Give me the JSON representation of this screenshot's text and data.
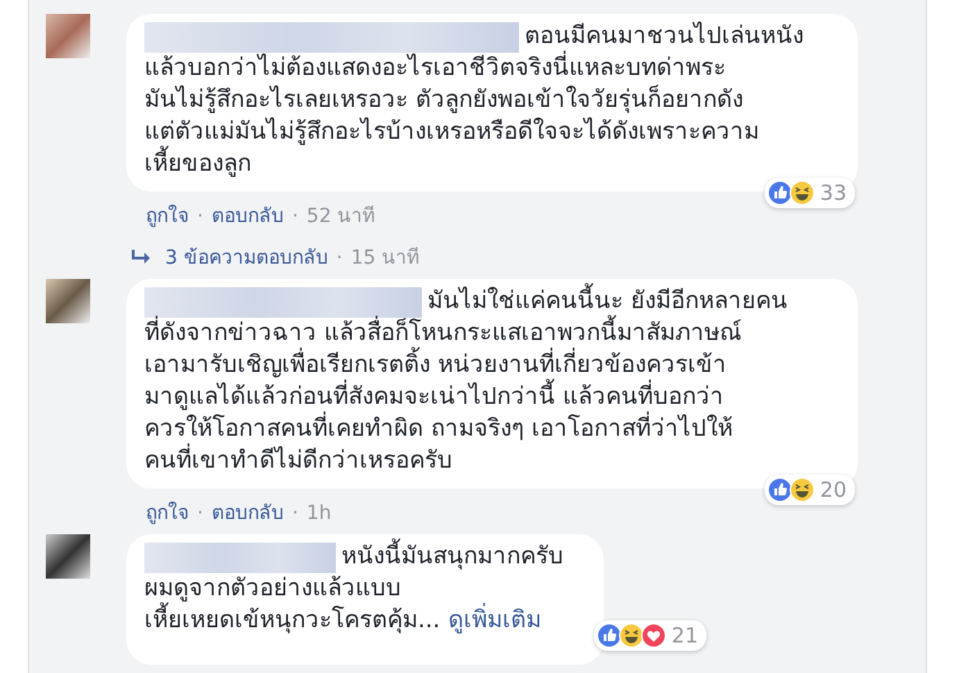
{
  "comments": [
    {
      "lines": [
        "ตอนมีคนมาชวนไปเล่นหนัง",
        "แล้วบอกว่าไม่ต้องแสดงอะไรเอาชีวิตจริงนี่แหละบทด่าพระ",
        "มันไม่รู้สึกอะไรเลยเหรอวะ ตัวลูกยังพอเข้าใจวัยรุ่นก็อยากดัง",
        "แต่ตัวแม่มันไม่รู้สึกอะไรบ้างเหรอหรือดีใจจะได้ดังเพราะความ",
        "เหี้ยของลูก"
      ],
      "reactions": {
        "icons": [
          {
            "kind": "like"
          },
          {
            "kind": "haha"
          }
        ],
        "count": "33"
      },
      "actions": [
        "ถูกใจ",
        "ตอบกลับ"
      ],
      "separator": "·",
      "time": "52 นาที",
      "replies": {
        "label": "3 ข้อความตอบกลับ",
        "time": "15 นาที"
      }
    },
    {
      "lines": [
        "มันไม่ใช่แค่คนนี้นะ ยังมีอีกหลายคน",
        "ที่ดังจากข่าวฉาว แล้วสื่อก็โหนกระแสเอาพวกนี้มาสัมภาษณ์",
        "เอามารับเชิญเพื่อเรียกเรตติ้ง หน่วยงานที่เกี่ยวข้องควรเข้า",
        "มาดูแลได้แล้วก่อนที่สังคมจะเน่าไปกว่านี้ แล้วคนที่บอกว่า",
        "ควรให้โอกาสคนที่เคยทำผิด ถามจริงๆ เอาโอกาสที่ว่าไปให้",
        "คนที่เขาทำดีไม่ดีกว่าเหรอครับ"
      ],
      "reactions": {
        "icons": [
          {
            "kind": "like"
          },
          {
            "kind": "haha"
          }
        ],
        "count": "20"
      },
      "actions": [
        "ถูกใจ",
        "ตอบกลับ"
      ],
      "separator": "·",
      "time": "1h"
    },
    {
      "lines": [
        "หนังนี้มันสนุกมากครับ",
        "ผมดูจากตัวอย่างแล้วแบบ",
        "เหี้ยเหยดเข้หนุกวะโครตคุ้ม..."
      ],
      "see_more": "ดูเพิ่มเติม",
      "reactions": {
        "icons": [
          {
            "kind": "like"
          },
          {
            "kind": "haha"
          },
          {
            "kind": "love"
          }
        ],
        "count": "21"
      }
    }
  ]
}
